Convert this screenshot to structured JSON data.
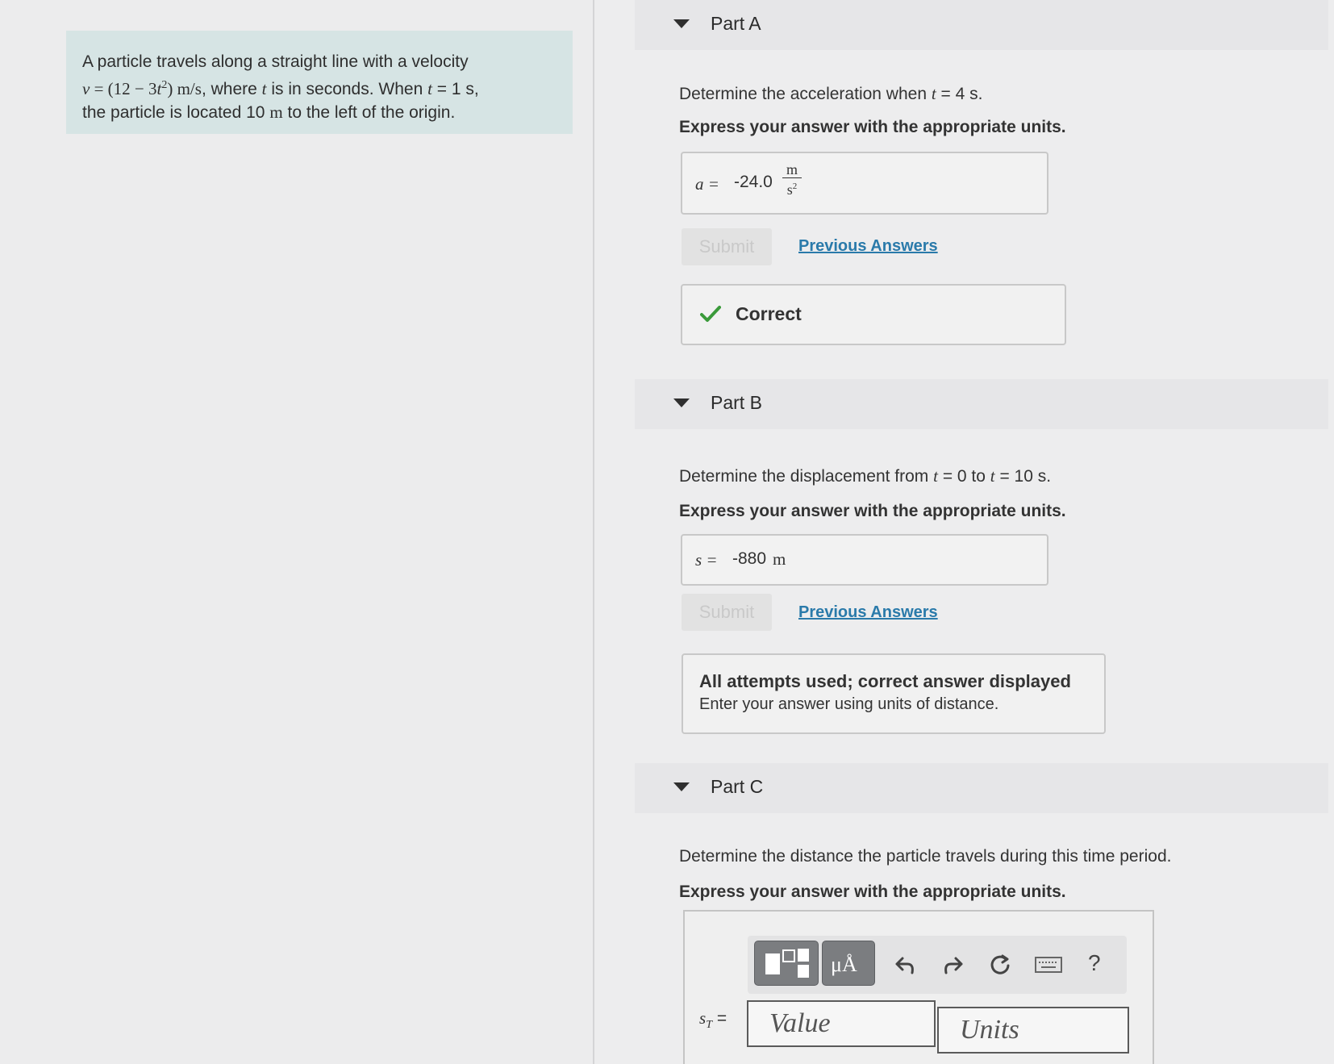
{
  "problem": {
    "line1": "A particle travels along a straight line with a velocity",
    "v_symbol": "v",
    "v_equals": " = (12 − 3",
    "v_t": "t",
    "v_sup": "2",
    "v_close": ") m/s",
    "where_text": ", where ",
    "t_symbol": "t",
    "is_seconds": " is in seconds. When ",
    "t_symbol2": "t",
    "when_value": " = 1 s,",
    "line3a": "the particle is located 10 ",
    "line3_unit": "m",
    "line3b": " to the left of the origin."
  },
  "part_a": {
    "title": "Part A",
    "prompt_pre": "Determine the acceleration when ",
    "prompt_var": "t",
    "prompt_post": " = 4 s.",
    "express": "Express your answer with the appropriate units.",
    "answer_label": "a =",
    "answer_value": "-24.0",
    "unit_num": "m",
    "unit_den": "s",
    "unit_den_sup": "2",
    "submit": "Submit",
    "previous": "Previous Answers",
    "feedback": "Correct"
  },
  "part_b": {
    "title": "Part B",
    "prompt_pre": "Determine the displacement from ",
    "prompt_var1": "t",
    "prompt_mid": " = 0 to ",
    "prompt_var2": "t",
    "prompt_post": " = 10 s.",
    "express": "Express your answer with the appropriate units.",
    "answer_label": "s =",
    "answer_value": "-880",
    "answer_unit": "m",
    "submit": "Submit",
    "previous": "Previous Answers",
    "feedback_title": "All attempts used; correct answer displayed",
    "feedback_text": "Enter your answer using units of distance."
  },
  "part_c": {
    "title": "Part C",
    "prompt": "Determine the distance the particle travels during this time period.",
    "express": "Express your answer with the appropriate units.",
    "answer_label": "s",
    "answer_label_sub": "T",
    "answer_equals": "=",
    "value_placeholder": "Value",
    "units_placeholder": "Units",
    "toolbar_units_button": "μÅ",
    "help": "?",
    "icons": [
      "templates-icon",
      "units-icon",
      "undo-icon",
      "redo-icon",
      "reset-icon",
      "keyboard-icon",
      "help-icon"
    ]
  },
  "colors": {
    "problem_bg": "#d6e4e4",
    "link": "#2a7aaa",
    "check": "#3a9a3a"
  }
}
